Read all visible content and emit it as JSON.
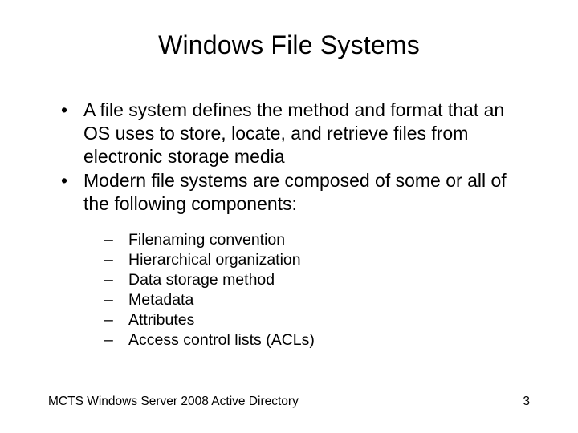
{
  "title": "Windows File Systems",
  "bullets": [
    "A file system defines the method and format that an OS uses to store, locate, and retrieve files from electronic storage media",
    "Modern file systems are composed of some or all of the following components:"
  ],
  "subitems": [
    "Filenaming convention",
    "Hierarchical organization",
    "Data storage method",
    "Metadata",
    "Attributes",
    "Access control lists  (ACLs)"
  ],
  "footer": {
    "left": "MCTS Windows Server 2008 Active Directory",
    "right": "3"
  }
}
